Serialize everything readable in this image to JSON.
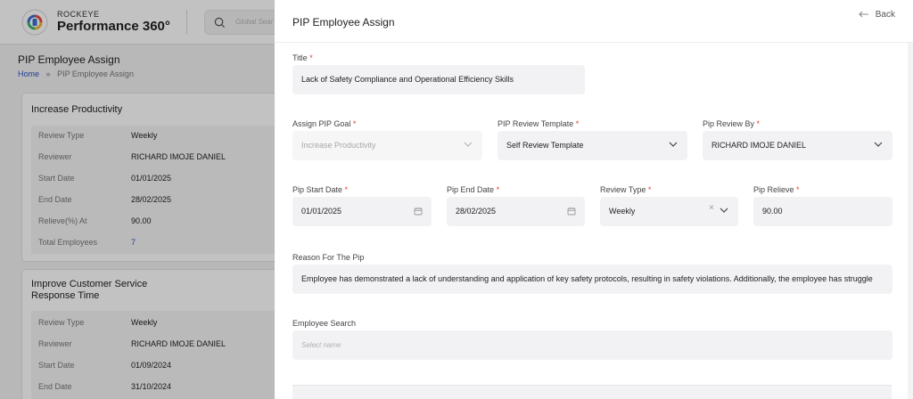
{
  "brand": {
    "small": "ROCKEYE",
    "name": "Performance 360°",
    "logo_icon": "p360-logo-icon"
  },
  "global_search": {
    "placeholder": "Global Sear"
  },
  "page": {
    "title": "PIP Employee Assign",
    "breadcrumb": {
      "home": "Home",
      "sep": "»",
      "current": "PIP Employee Assign"
    }
  },
  "cards": [
    {
      "title": "Increase Productivity",
      "rows": [
        {
          "label": "Review Type",
          "value": "Weekly"
        },
        {
          "label": "Reviewer",
          "value": "RICHARD IMOJE DANIEL"
        },
        {
          "label": "Start Date",
          "value": "01/01/2025"
        },
        {
          "label": "End Date",
          "value": "28/02/2025"
        },
        {
          "label": "Relieve(%) At",
          "value": "90.00"
        },
        {
          "label": "Total Employees",
          "value": "7"
        }
      ]
    },
    {
      "title_line1": "Improve Customer Service",
      "title_line2": "Response Time",
      "rows": [
        {
          "label": "Review Type",
          "value": "Weekly"
        },
        {
          "label": "Reviewer",
          "value": "RICHARD IMOJE DANIEL"
        },
        {
          "label": "Start Date",
          "value": "01/09/2024"
        },
        {
          "label": "End Date",
          "value": "31/10/2024"
        }
      ]
    }
  ],
  "drawer": {
    "title": "PIP Employee Assign",
    "back_label": "Back",
    "required_mark": "*",
    "fields": {
      "title": {
        "label": "Title",
        "value": "Lack of Safety Compliance and Operational Efficiency Skills"
      },
      "assign_pip_goal": {
        "label": "Assign PIP Goal",
        "value": "Increase Productivity"
      },
      "pip_review_template": {
        "label": "PIP Review Template",
        "value": "Self Review Template"
      },
      "pip_review_by": {
        "label": "Pip Review By",
        "value": "RICHARD IMOJE DANIEL"
      },
      "pip_start_date": {
        "label": "Pip Start Date",
        "value": "01/01/2025"
      },
      "pip_end_date": {
        "label": "Pip End Date",
        "value": "28/02/2025"
      },
      "review_type": {
        "label": "Review Type",
        "value": "Weekly",
        "clear": "×"
      },
      "pip_relieve": {
        "label": "Pip Relieve",
        "value": "90.00"
      },
      "reason": {
        "label": "Reason For The Pip",
        "value": "Employee has demonstrated a lack of understanding and application of key safety protocols, resulting in safety violations. Additionally, the employee has struggle"
      },
      "employee_search": {
        "label": "Employee Search",
        "placeholder": "Select name"
      }
    }
  }
}
